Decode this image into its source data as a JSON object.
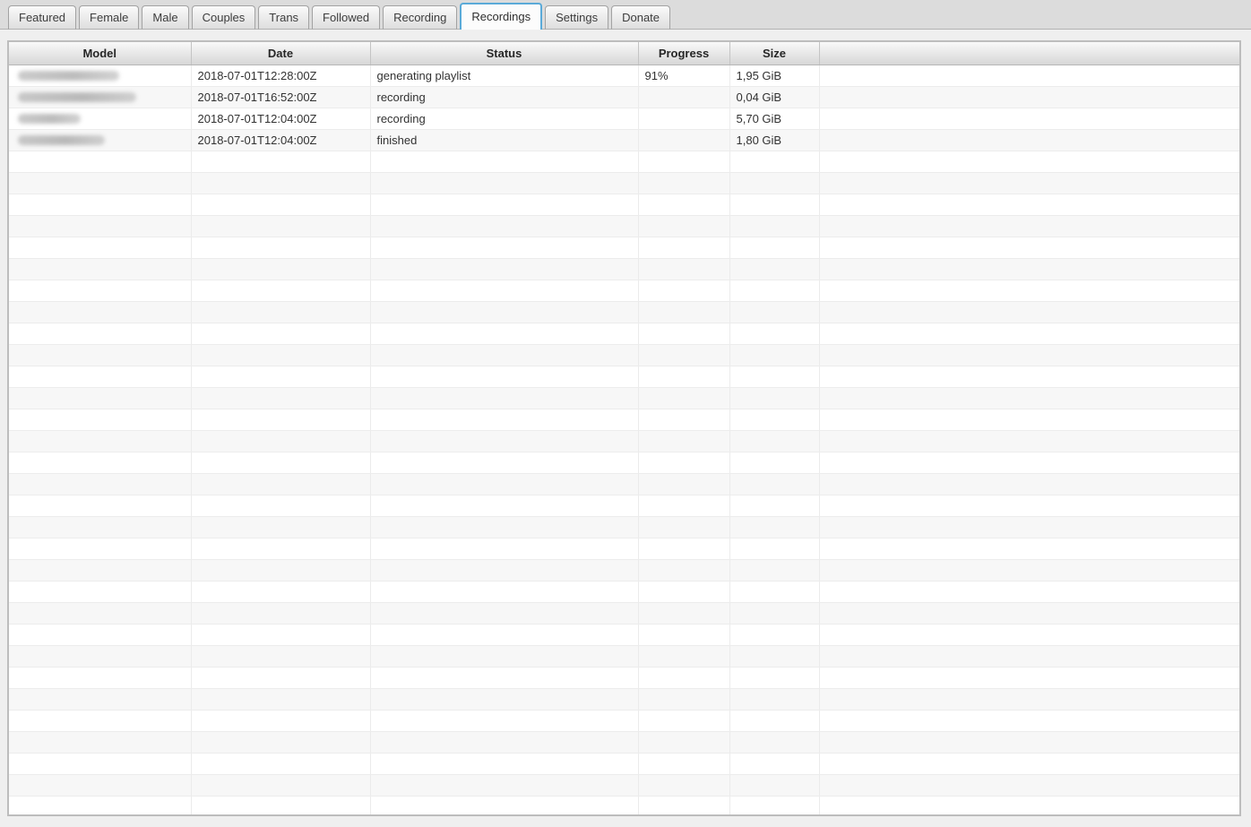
{
  "tabs": {
    "active": "Recordings",
    "items": [
      {
        "label": "Featured"
      },
      {
        "label": "Female"
      },
      {
        "label": "Male"
      },
      {
        "label": "Couples"
      },
      {
        "label": "Trans"
      },
      {
        "label": "Followed"
      },
      {
        "label": "Recording"
      },
      {
        "label": "Recordings"
      },
      {
        "label": "Settings"
      },
      {
        "label": "Donate"
      }
    ]
  },
  "table": {
    "columns": [
      "Model",
      "Date",
      "Status",
      "Progress",
      "Size",
      ""
    ],
    "rows": [
      {
        "model_redacted": true,
        "redacted_width": 113,
        "date": "2018-07-01T12:28:00Z",
        "status": "generating playlist",
        "progress": "91%",
        "size": "1,95 GiB"
      },
      {
        "model_redacted": true,
        "redacted_width": 132,
        "date": "2018-07-01T16:52:00Z",
        "status": "recording",
        "progress": "",
        "size": "0,04 GiB"
      },
      {
        "model_redacted": true,
        "redacted_width": 70,
        "date": "2018-07-01T12:04:00Z",
        "status": "recording",
        "progress": "",
        "size": "5,70 GiB"
      },
      {
        "model_redacted": true,
        "redacted_width": 97,
        "date": "2018-07-01T12:04:00Z",
        "status": "finished",
        "progress": "",
        "size": "1,80 GiB"
      }
    ],
    "empty_row_count": 31
  },
  "colors": {
    "active_tab_border": "#5aaad8",
    "tabbar_background": "#dcdcdc",
    "row_stripe": "#f7f7f7",
    "header_gradient_top": "#f9f9f9",
    "header_gradient_bottom": "#d7d7d7"
  }
}
